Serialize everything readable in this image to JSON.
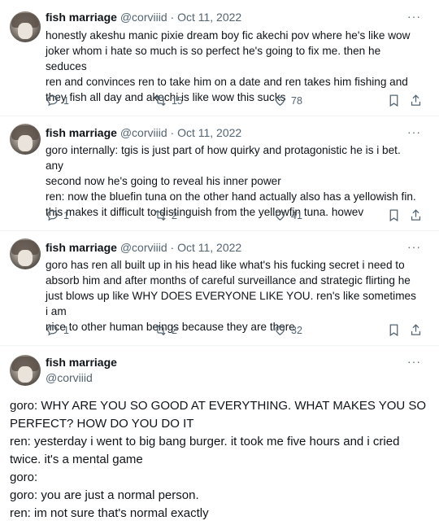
{
  "tweets": [
    {
      "name": "fish marriage",
      "handle": "@corviiid",
      "dot": "·",
      "date": "Oct 11, 2022",
      "more": "···",
      "lines": [
        "honestly akeshu manic pixie dream boy fic akechi pov where he's like wow",
        "joker whom i hate so much is so perfect he's going to fix me. then he seduces",
        "ren and convinces ren to take him on a date and ren takes him fishing and",
        "they fish all day and akechi is like wow this sucks"
      ],
      "replies": "1",
      "retweets": "15",
      "likes": "78"
    },
    {
      "name": "fish marriage",
      "handle": "@corviiid",
      "dot": "·",
      "date": "Oct 11, 2022",
      "more": "···",
      "lines": [
        "goro internally: tgis is just part of how quirky and protagonistic he is i bet. any",
        "second now he's going to reveal his inner power",
        "ren: now the bluefin tuna on the other hand actually also has a yellowish fin.",
        "this makes it difficult to distinguish from the yellowfin tuna. howev"
      ],
      "replies": "1",
      "retweets": "2",
      "likes": "41"
    },
    {
      "name": "fish marriage",
      "handle": "@corviiid",
      "dot": "·",
      "date": "Oct 11, 2022",
      "more": "···",
      "lines": [
        "goro has ren all built up in his head like what's his fucking secret i need to",
        "absorb him and after months of careful surveillance and strategic flirting he",
        "just blows up like WHY DOES EVERYONE LIKE YOU. ren's like sometimes i am",
        "nice to other human beings because they are there"
      ],
      "replies": "1",
      "retweets": "2",
      "likes": "32"
    }
  ],
  "main": {
    "name": "fish marriage",
    "handle": "@corviiid",
    "more": "···",
    "lines": [
      "goro: WHY ARE YOU SO GOOD AT EVERYTHING. WHAT MAKES YOU SO",
      "PERFECT? HOW DO YOU DO IT",
      "ren: yesterday i went to big bang burger. it took me five hours and i cried",
      "twice. it's a mental game",
      "goro:",
      "goro: you are just a normal person.",
      "ren: im not sure that's normal exactly"
    ]
  },
  "colors": {
    "text": "#0f1419",
    "secondary": "#536471",
    "divider": "#eff3f4"
  },
  "icons": [
    "reply-icon",
    "retweet-icon",
    "like-icon",
    "bookmark-icon",
    "share-icon",
    "more-icon"
  ]
}
